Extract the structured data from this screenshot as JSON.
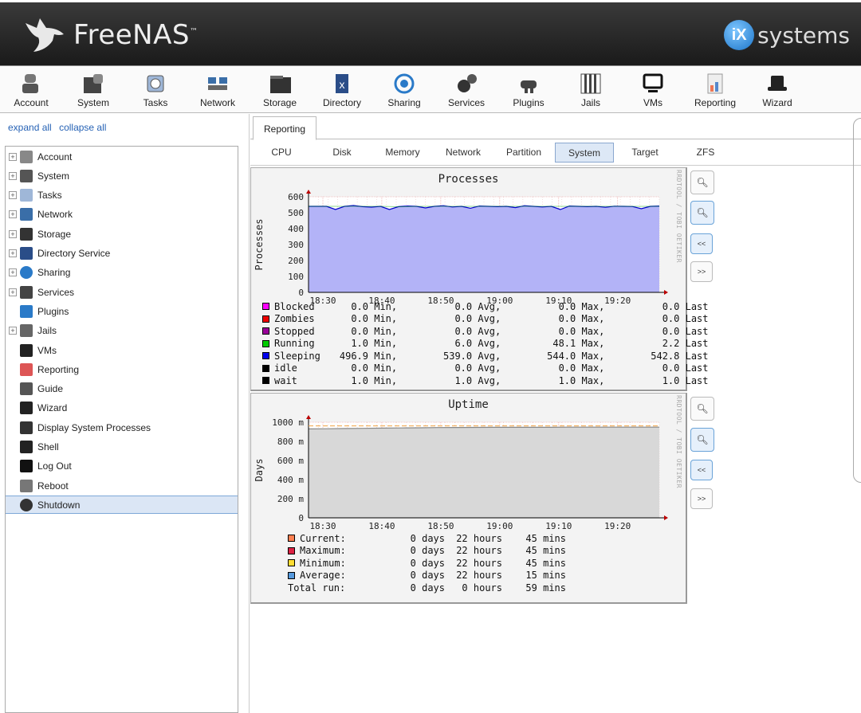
{
  "header": {
    "brand": "FreeNAS",
    "brand_mark": "™",
    "vendor_mark": "iX",
    "vendor": "systems"
  },
  "toolbar": {
    "items": [
      {
        "label": "Account",
        "icon": "account-icon"
      },
      {
        "label": "System",
        "icon": "system-icon"
      },
      {
        "label": "Tasks",
        "icon": "tasks-icon"
      },
      {
        "label": "Network",
        "icon": "network-icon"
      },
      {
        "label": "Storage",
        "icon": "storage-icon"
      },
      {
        "label": "Directory",
        "icon": "directory-icon"
      },
      {
        "label": "Sharing",
        "icon": "sharing-icon"
      },
      {
        "label": "Services",
        "icon": "services-icon"
      },
      {
        "label": "Plugins",
        "icon": "plugins-icon"
      },
      {
        "label": "Jails",
        "icon": "jails-icon"
      },
      {
        "label": "VMs",
        "icon": "vms-icon"
      },
      {
        "label": "Reporting",
        "icon": "reporting-icon"
      },
      {
        "label": "Wizard",
        "icon": "wizard-icon"
      }
    ]
  },
  "sidebar": {
    "expand_all": "expand all",
    "collapse_all": "collapse all",
    "items": [
      {
        "label": "Account",
        "expandable": true
      },
      {
        "label": "System",
        "expandable": true
      },
      {
        "label": "Tasks",
        "expandable": true
      },
      {
        "label": "Network",
        "expandable": true
      },
      {
        "label": "Storage",
        "expandable": true
      },
      {
        "label": "Directory Service",
        "expandable": true
      },
      {
        "label": "Sharing",
        "expandable": true
      },
      {
        "label": "Services",
        "expandable": true
      },
      {
        "label": "Plugins",
        "expandable": false
      },
      {
        "label": "Jails",
        "expandable": true
      },
      {
        "label": "VMs",
        "expandable": false
      },
      {
        "label": "Reporting",
        "expandable": false
      },
      {
        "label": "Guide",
        "expandable": false
      },
      {
        "label": "Wizard",
        "expandable": false
      },
      {
        "label": "Display System Processes",
        "expandable": false
      },
      {
        "label": "Shell",
        "expandable": false
      },
      {
        "label": "Log Out",
        "expandable": false
      },
      {
        "label": "Reboot",
        "expandable": false
      },
      {
        "label": "Shutdown",
        "expandable": false,
        "selected": true
      }
    ]
  },
  "main": {
    "tab": "Reporting",
    "subtabs": [
      "CPU",
      "Disk",
      "Memory",
      "Network",
      "Partition",
      "System",
      "Target",
      "ZFS"
    ],
    "selected_subtab": "System"
  },
  "zoom": {
    "zoom_in": "+",
    "zoom_out": "-",
    "prev": "<<",
    "next": ">>"
  },
  "chart_data": [
    {
      "type": "area",
      "title": "Processes",
      "ylabel": "Processes",
      "side_label": "RRDTOOL / TOBI OETIKER",
      "x_ticks": [
        "18:30",
        "18:40",
        "18:50",
        "19:00",
        "19:10",
        "19:20"
      ],
      "y_ticks": [
        "0",
        "100",
        "200",
        "300",
        "400",
        "500",
        "600"
      ],
      "ylim": [
        0,
        600
      ],
      "series": [
        {
          "name": "Blocked",
          "color": "#ff00ff",
          "min": "0.0",
          "avg": "0.0",
          "max": "0.0",
          "last": "0.0"
        },
        {
          "name": "Zombies",
          "color": "#ee0000",
          "min": "0.0",
          "avg": "0.0",
          "max": "0.0",
          "last": "0.0"
        },
        {
          "name": "Stopped",
          "color": "#9a0099",
          "min": "0.0",
          "avg": "0.0",
          "max": "0.0",
          "last": "0.0"
        },
        {
          "name": "Running",
          "color": "#00cc00",
          "min": "1.0",
          "avg": "6.0",
          "max": "48.1",
          "last": "2.2"
        },
        {
          "name": "Sleeping",
          "color": "#0000ee",
          "min": "496.9",
          "avg": "539.0",
          "max": "544.0",
          "last": "542.8"
        },
        {
          "name": "idle",
          "color": "#000000",
          "min": "0.0",
          "avg": "0.0",
          "max": "0.0",
          "last": "0.0"
        },
        {
          "name": "wait",
          "color": "#000000",
          "min": "1.0",
          "avg": "1.0",
          "max": "1.0",
          "last": "1.0"
        }
      ],
      "sleeping_values": [
        540,
        540,
        540,
        520,
        540,
        545,
        538,
        535,
        540,
        520,
        538,
        542,
        540,
        530,
        540,
        544,
        536,
        540,
        528,
        542,
        540,
        538,
        540,
        532,
        544,
        540,
        536,
        540,
        520,
        542,
        540,
        538,
        540,
        534,
        541,
        540,
        539,
        525,
        540,
        542
      ]
    },
    {
      "type": "area",
      "title": "Uptime",
      "ylabel": "Days",
      "side_label": "RRDTOOL / TOBI OETIKER",
      "x_ticks": [
        "18:30",
        "18:40",
        "18:50",
        "19:00",
        "19:10",
        "19:20"
      ],
      "y_ticks": [
        "0",
        "200 m",
        "400 m",
        "600 m",
        "800 m",
        "1000 m"
      ],
      "ylim": [
        0,
        1000
      ],
      "series": [
        {
          "name": "Current:",
          "color": "#ff7f50",
          "days": "0 days",
          "hours": "22 hours",
          "mins": "45 mins"
        },
        {
          "name": "Maximum:",
          "color": "#dd2244",
          "days": "0 days",
          "hours": "22 hours",
          "mins": "45 mins"
        },
        {
          "name": "Minimum:",
          "color": "#ffdd33",
          "days": "0 days",
          "hours": "22 hours",
          "mins": "45 mins"
        },
        {
          "name": "Average:",
          "color": "#5599dd",
          "days": "0 days",
          "hours": "22 hours",
          "mins": "15 mins"
        }
      ],
      "total": {
        "name": "Total run:",
        "days": "0 days",
        "hours": "0 hours",
        "mins": "59 mins"
      },
      "current_values": [
        930,
        932,
        934,
        936,
        938,
        940,
        942,
        944,
        945,
        946,
        947,
        947,
        947,
        947,
        948,
        948,
        948,
        948,
        948,
        948
      ]
    }
  ]
}
